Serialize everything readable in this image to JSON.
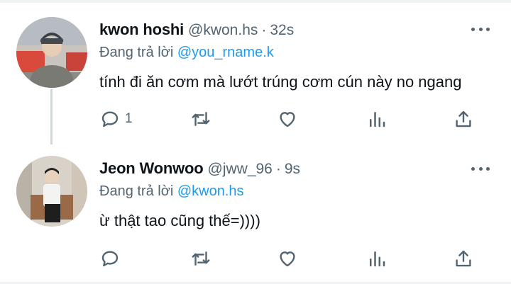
{
  "tweets": [
    {
      "display_name": "kwon hoshi",
      "handle": "@kwon.hs",
      "separator": "·",
      "time": "32s",
      "replying_prefix": "Đang trả lời",
      "replying_to": "@you_rname.k",
      "text": "tính đi ăn cơm mà lướt trúng cơm cún này no ngang",
      "reply_count": "1",
      "retweet_count": "",
      "like_count": ""
    },
    {
      "display_name": "Jeon Wonwoo",
      "handle": "@jww_96",
      "separator": "·",
      "time": "9s",
      "replying_prefix": "Đang trả lời",
      "replying_to": "@kwon.hs",
      "text": "ừ thật tao cũng thế=))))",
      "reply_count": "",
      "retweet_count": "",
      "like_count": ""
    }
  ],
  "colors": {
    "accent": "#1d9bf0",
    "text_primary": "#0f1419",
    "text_secondary": "#536471",
    "thread_line": "#cfd9de"
  },
  "icons": [
    "more-icon",
    "reply-icon",
    "retweet-icon",
    "like-icon",
    "views-icon",
    "share-icon"
  ]
}
